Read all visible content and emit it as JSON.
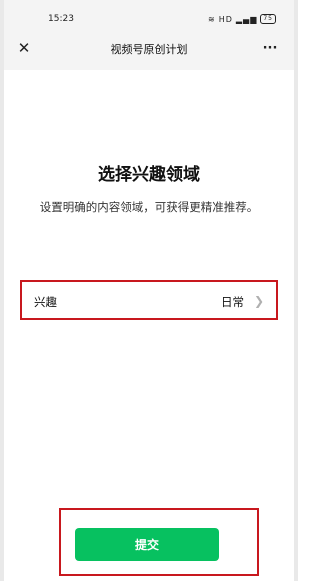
{
  "status_bar": {
    "time": "15:23",
    "signal": "HD",
    "battery": "75"
  },
  "nav": {
    "title": "视频号原创计划",
    "close_icon": "close-icon",
    "more_icon": "more-icon"
  },
  "content": {
    "heading": "选择兴趣领域",
    "description": "设置明确的内容领域，可获得更精准推荐。"
  },
  "interest": {
    "label": "兴趣",
    "value": "日常"
  },
  "actions": {
    "submit_label": "提交"
  },
  "colors": {
    "primary": "#07c160",
    "highlight_border": "#c8181e"
  }
}
